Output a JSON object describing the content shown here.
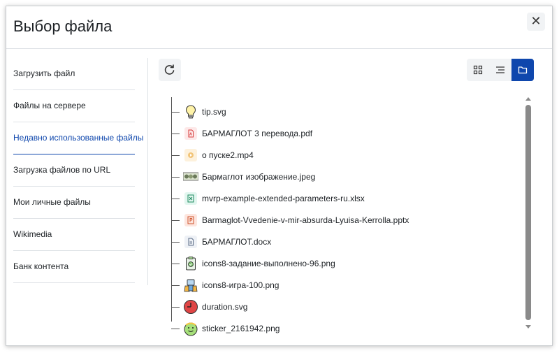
{
  "dialog": {
    "title": "Выбор файла",
    "close_label": "✕"
  },
  "sidebar": {
    "items": [
      {
        "label": "Загрузить файл"
      },
      {
        "label": "Файлы на сервере"
      },
      {
        "label": "Недавно использованные файлы",
        "active": true
      },
      {
        "label": "Загрузка файлов по URL"
      },
      {
        "label": "Мои личные файлы"
      },
      {
        "label": "Wikimedia"
      },
      {
        "label": "Банк контента"
      }
    ]
  },
  "toolbar": {
    "refresh_icon": "refresh-icon",
    "views": [
      {
        "icon": "grid-view-icon"
      },
      {
        "icon": "list-view-icon"
      },
      {
        "icon": "tree-view-icon",
        "active": true
      }
    ]
  },
  "files": [
    {
      "name": "tip.svg",
      "icon": "lightbulb-icon"
    },
    {
      "name": "БАРМАГЛОТ 3 перевода.pdf",
      "icon": "pdf-icon"
    },
    {
      "name": "о пуске2.mp4",
      "icon": "video-icon"
    },
    {
      "name": "Бармаглот изображение.jpeg",
      "icon": "image-thumbnail-icon"
    },
    {
      "name": "mvrp-example-extended-parameters-ru.xlsx",
      "icon": "spreadsheet-icon"
    },
    {
      "name": "Barmaglot-Vvedenie-v-mir-absurda-Lyuisa-Kerrolla.pptx",
      "icon": "presentation-icon"
    },
    {
      "name": "БАРМАГЛОТ.docx",
      "icon": "document-icon"
    },
    {
      "name": "icons8-задание-выполнено-96.png",
      "icon": "clipboard-check-icon"
    },
    {
      "name": "icons8-игра-100.png",
      "icon": "game-icon"
    },
    {
      "name": "duration.svg",
      "icon": "clock-icon"
    },
    {
      "name": "sticker_2161942.png",
      "icon": "sticker-icon"
    }
  ],
  "colors": {
    "accent": "#0f47ad",
    "button_bg": "#f1f3f5",
    "border": "#dee2e6"
  }
}
